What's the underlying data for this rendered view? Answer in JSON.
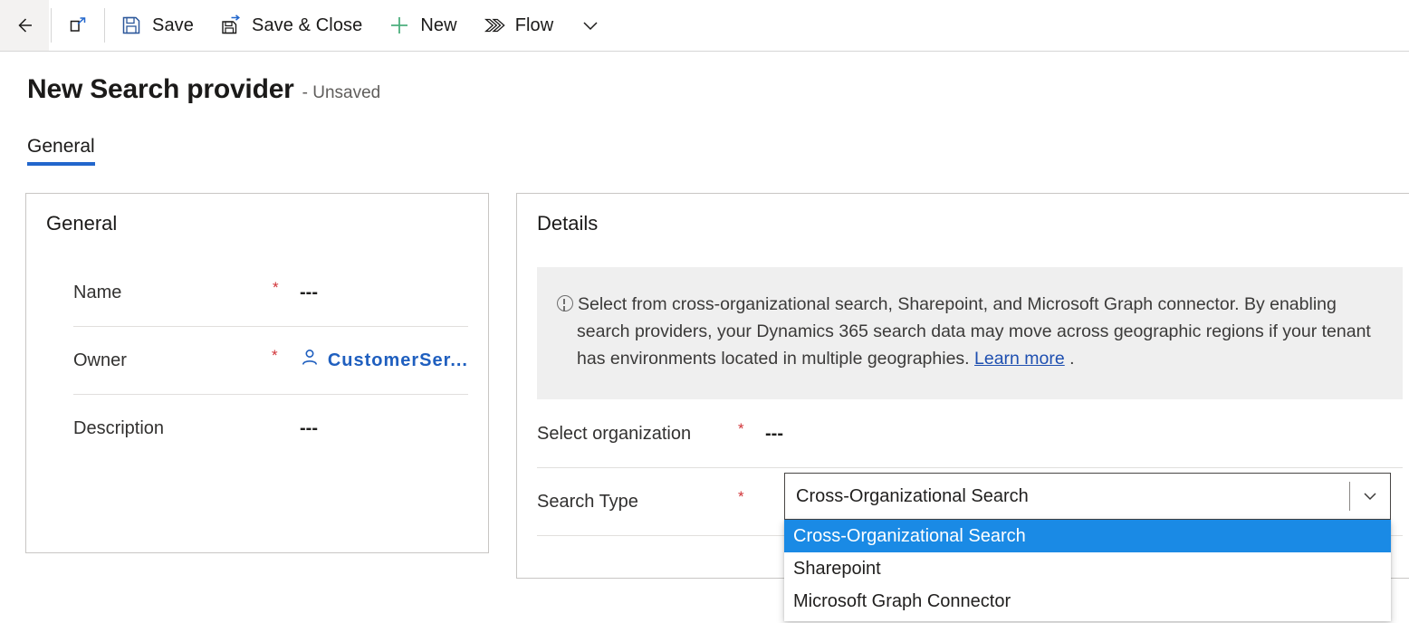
{
  "commandbar": {
    "items": [
      {
        "name": "back-button",
        "icon": "back-arrow-icon",
        "label": ""
      },
      {
        "name": "popout-button",
        "icon": "popout-icon",
        "label": ""
      },
      {
        "name": "save-button",
        "icon": "save-icon",
        "label": "Save"
      },
      {
        "name": "save-close-button",
        "icon": "save-close-icon",
        "label": "Save & Close"
      },
      {
        "name": "new-button",
        "icon": "plus-icon",
        "label": "New"
      },
      {
        "name": "flow-button",
        "icon": "flow-icon",
        "label": "Flow"
      },
      {
        "name": "overflow-button",
        "icon": "chevron-down-icon",
        "label": ""
      }
    ]
  },
  "header": {
    "title": "New Search provider",
    "status": "- Unsaved"
  },
  "tabs": [
    {
      "label": "General",
      "active": true
    }
  ],
  "general_card": {
    "title": "General",
    "fields": [
      {
        "label": "Name",
        "required": "*",
        "value": "---",
        "type": "text"
      },
      {
        "label": "Owner",
        "required": "*",
        "value": "CustomerSer...",
        "type": "lookup"
      },
      {
        "label": "Description",
        "required": "",
        "value": "---",
        "type": "text"
      }
    ]
  },
  "details_card": {
    "title": "Details",
    "notice": {
      "text": "Select from cross-organizational search, Sharepoint, and Microsoft Graph connector. By enabling search providers, your Dynamics 365 search data may move across geographic regions if your tenant has environments located in multiple geographies. ",
      "link": "Learn more",
      "suffix": " ."
    },
    "fields": [
      {
        "label": "Select organization",
        "required": "*",
        "value": "---"
      },
      {
        "label": "Search Type",
        "required": "*",
        "value": ""
      }
    ]
  },
  "search_type_combobox": {
    "value": "Cross-Organizational Search",
    "expanded": true,
    "options": [
      {
        "label": "Cross-Organizational Search",
        "selected": true
      },
      {
        "label": "Sharepoint",
        "selected": false
      },
      {
        "label": "Microsoft Graph Connector",
        "selected": false
      }
    ]
  },
  "colors": {
    "accent": "#2266cc",
    "highlight": "#1a8ae5",
    "link": "#1f5fbf",
    "required": "#d13438",
    "notice_bg": "#efefef",
    "save_icon": "#2b579a",
    "new_icon": "#4caf7d"
  }
}
